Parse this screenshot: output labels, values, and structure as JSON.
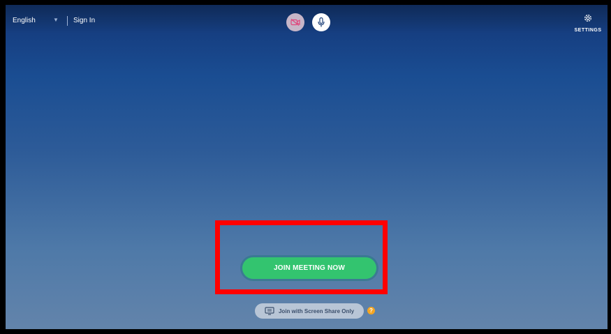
{
  "topbar": {
    "language": "English",
    "sign_in": "Sign In",
    "settings_label": "SETTINGS"
  },
  "controls": {
    "camera_icon": "camera-off-icon",
    "mic_icon": "microphone-icon",
    "settings_icon": "gear-icon"
  },
  "main": {
    "join_label": "JOIN MEETING NOW",
    "screen_share_label": "Join with Screen Share Only",
    "help_label": "?"
  },
  "colors": {
    "accent_green": "#33c46f",
    "highlight_red": "#ff0000",
    "help_orange": "#f5a623"
  }
}
